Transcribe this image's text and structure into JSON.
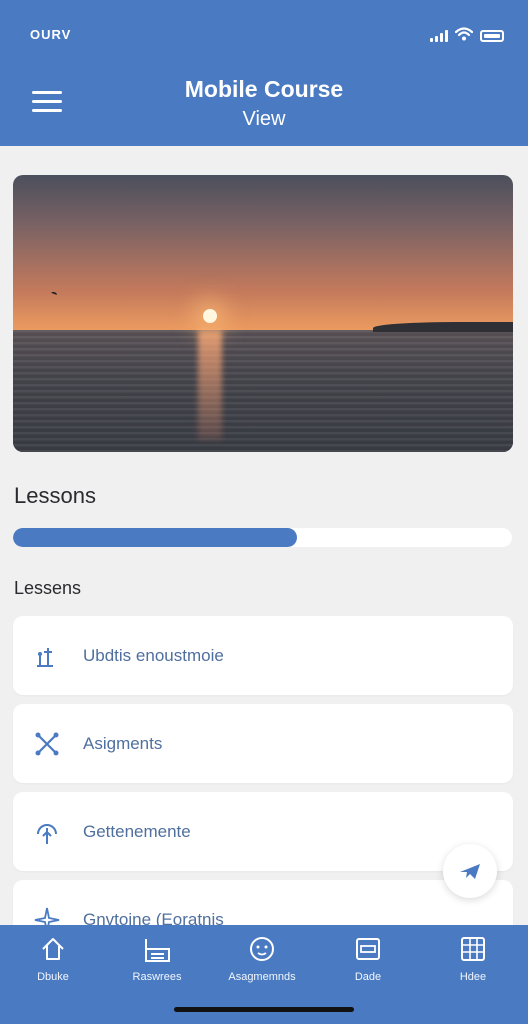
{
  "status_bar": {
    "carrier": "OURV"
  },
  "header": {
    "title": "Mobile Course",
    "subtitle": "View"
  },
  "hero_image": {
    "description_icon": "sunset-photo"
  },
  "progress_section": {
    "title": "Lessons",
    "progress_percent": 57
  },
  "list": {
    "heading": "Lessens",
    "items": [
      {
        "label": "Ubdtis enoustmoie",
        "icon": "pin-icon"
      },
      {
        "label": "Asigments",
        "icon": "tools-icon"
      },
      {
        "label": "Gettenemente",
        "icon": "antenna-icon"
      },
      {
        "label": "Gnvtoine (Eoratnis",
        "icon": "sparkle-icon"
      }
    ]
  },
  "fab": {
    "icon": "plane-icon"
  },
  "tabbar": {
    "tabs": [
      {
        "label": "Dbuke",
        "icon": "home-icon"
      },
      {
        "label": "Raswrees",
        "icon": "resources-icon"
      },
      {
        "label": "Asagmemnds",
        "icon": "assignments-icon"
      },
      {
        "label": "Dade",
        "icon": "grade-icon"
      },
      {
        "label": "Hdee",
        "icon": "grid-icon"
      }
    ]
  },
  "colors": {
    "primary": "#4a7bc2",
    "background": "#f0f0f1",
    "card": "#ffffff",
    "list_text": "#4f6f9e"
  }
}
